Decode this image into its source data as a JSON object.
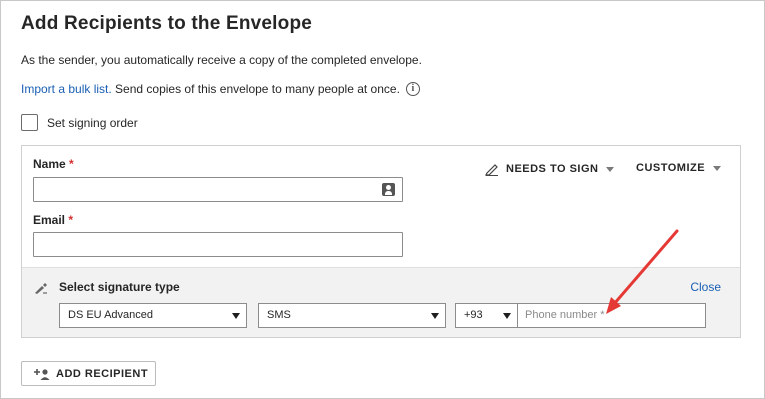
{
  "page": {
    "title": "Add Recipients to the Envelope",
    "sender_note": "As the sender, you automatically receive a copy of the completed envelope.",
    "bulk_link": "Import a bulk list.",
    "bulk_text": " Send copies of this envelope to many people at once.",
    "info_glyph": "i",
    "signing_order_label": "Set signing order"
  },
  "recipient": {
    "name_label": "Name",
    "email_label": "Email",
    "required_mark": " *",
    "name_value": "",
    "email_value": "",
    "needs_to_sign": "NEEDS TO SIGN",
    "customize": "CUSTOMIZE"
  },
  "signature": {
    "title": "Select signature type",
    "close": "Close",
    "type_selected": "DS EU Advanced",
    "method_selected": "SMS",
    "country_code": "+93",
    "phone_placeholder": "Phone number *"
  },
  "footer": {
    "add_recipient": "ADD RECIPIENT"
  },
  "colors": {
    "link": "#1a5fb4",
    "required": "#d32f2f",
    "annotation_arrow": "#e53935",
    "panel_bg": "#f2f2f2"
  },
  "icons": [
    "info-icon",
    "contact-card-icon",
    "pen-icon",
    "signature-pen-icon",
    "add-person-icon",
    "annotation-arrow"
  ]
}
